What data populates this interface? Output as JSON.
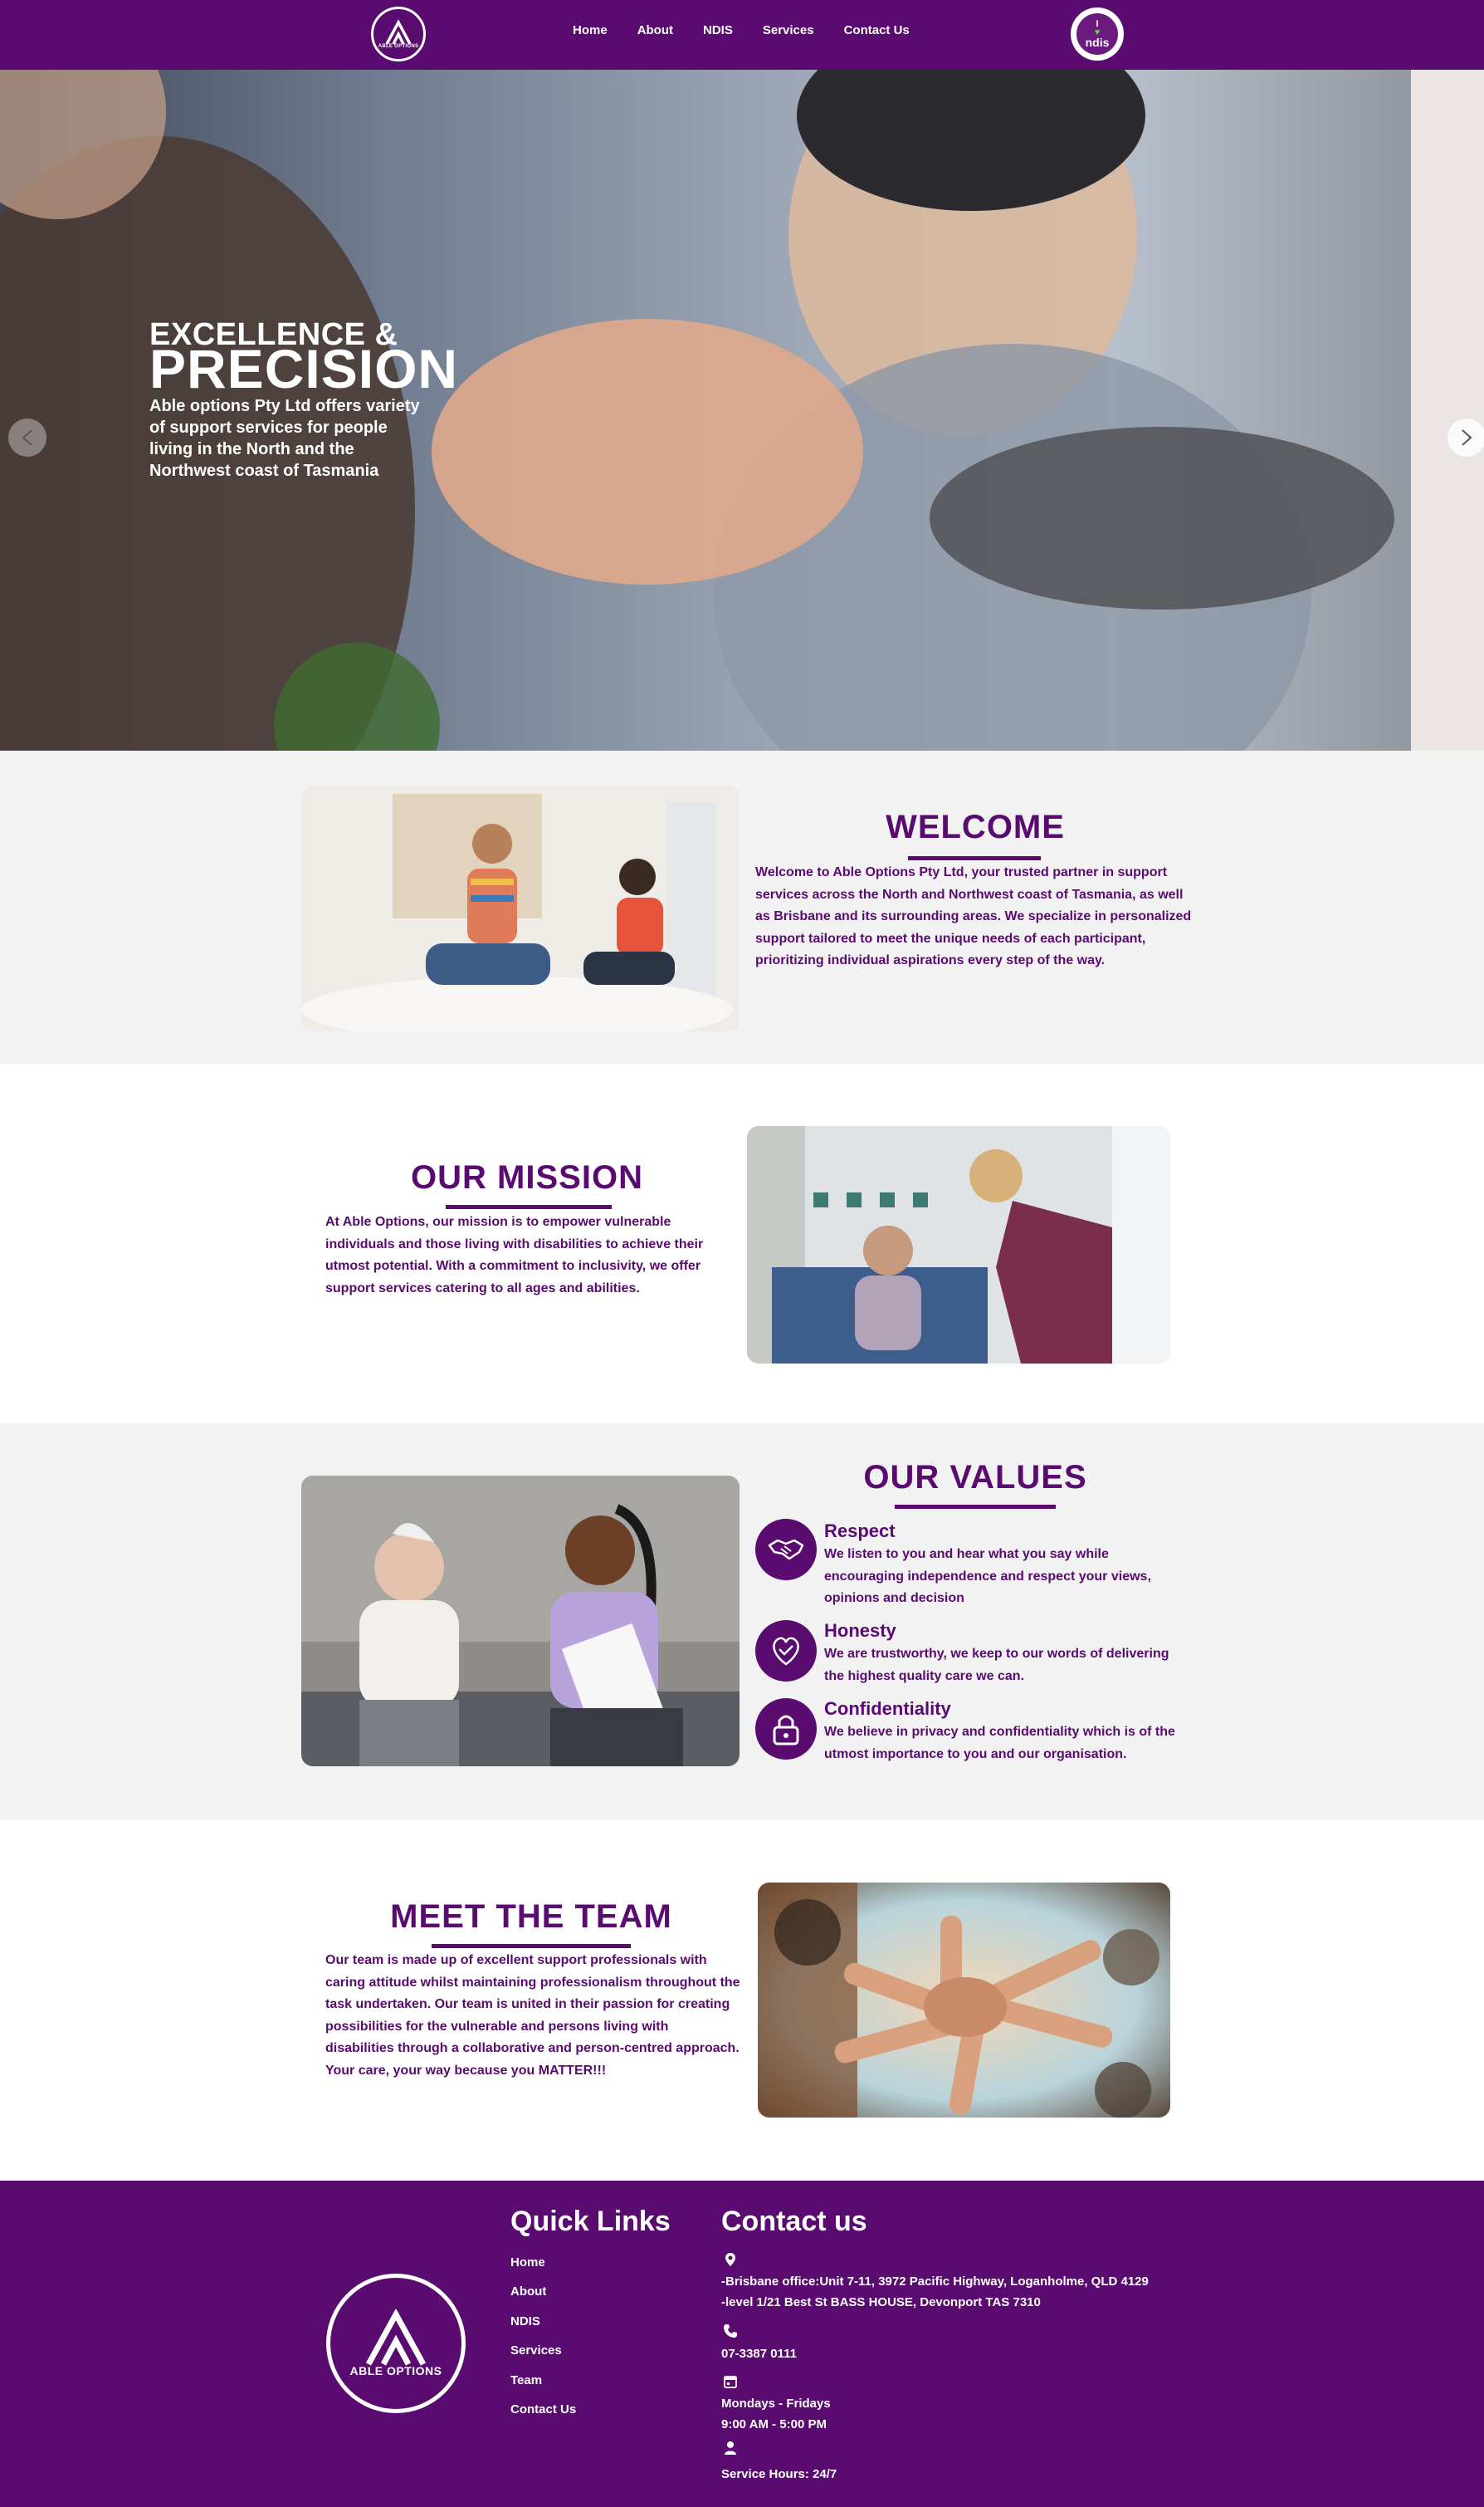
{
  "nav": {
    "logo_text": "ABLE OPTIONS",
    "links": [
      "Home",
      "About",
      "NDIS",
      "Services",
      "Contact Us"
    ],
    "ndis_badge": {
      "i": "I",
      "word": "ndis"
    }
  },
  "hero": {
    "title_line1": "EXCELLENCE &",
    "title_line2": "PRECISION",
    "text": "Able options Pty Ltd offers variety of support services for people living in the North and the Northwest coast of Tasmania",
    "prev_icon": "chevron-left-icon",
    "next_icon": "chevron-right-icon"
  },
  "welcome": {
    "heading": "WELCOME",
    "text": "Welcome to Able Options Pty Ltd, your trusted partner in support services across the North and Northwest coast of Tasmania, as well as Brisbane and its surrounding areas. We specialize in personalized support tailored to meet the unique needs of each participant, prioritizing individual aspirations every step of the way."
  },
  "mission": {
    "heading": "OUR MISSION",
    "text": "At Able Options, our mission is to empower vulnerable individuals and those living with disabilities to achieve their utmost potential. With a commitment to inclusivity, we offer support services catering to all ages and abilities."
  },
  "values": {
    "heading": "OUR VALUES",
    "items": [
      {
        "title": "Respect",
        "text": "We listen to you and hear what you say while encouraging independence and respect your views, opinions and decision",
        "icon": "handshake-icon"
      },
      {
        "title": "Honesty",
        "text": "We are trustworthy, we keep to our words of delivering the highest quality care we can.",
        "icon": "heart-hand-icon"
      },
      {
        "title": "Confidentiality",
        "text": "We believe in privacy and confidentiality which is of the utmost importance to you and our organisation.",
        "icon": "lock-icon"
      }
    ]
  },
  "team": {
    "heading": "MEET THE TEAM",
    "text": "Our team is made up of excellent support professionals with caring attitude whilst maintaining professionalism throughout the task undertaken. Our team is united in their passion for creating possibilities for the vulnerable and persons living with disabilities through a collaborative and person-centred approach. Your care, your way because you MATTER!!!"
  },
  "footer": {
    "logo_text": "ABLE OPTIONS",
    "quick_links_heading": "Quick Links",
    "quick_links": [
      "Home",
      "About",
      "NDIS",
      "Services",
      "Team",
      "Contact Us"
    ],
    "contact_heading": "Contact us",
    "address_line1": "-Brisbane office:Unit 7-11, 3972 Pacific Highway, Loganholme, QLD 4129",
    "address_line2": "-level 1/21 Best St BASS HOUSE, Devonport TAS 7310",
    "phone": "07-3387 0111",
    "days": "Mondays - Fridays",
    "hours": "9:00 AM - 5:00 PM",
    "service_hours": "Service Hours: 24/7"
  },
  "colors": {
    "brand": "#5a0b6f",
    "grey_bg": "#f2f2f2",
    "ndis_green": "#6fd14b"
  }
}
